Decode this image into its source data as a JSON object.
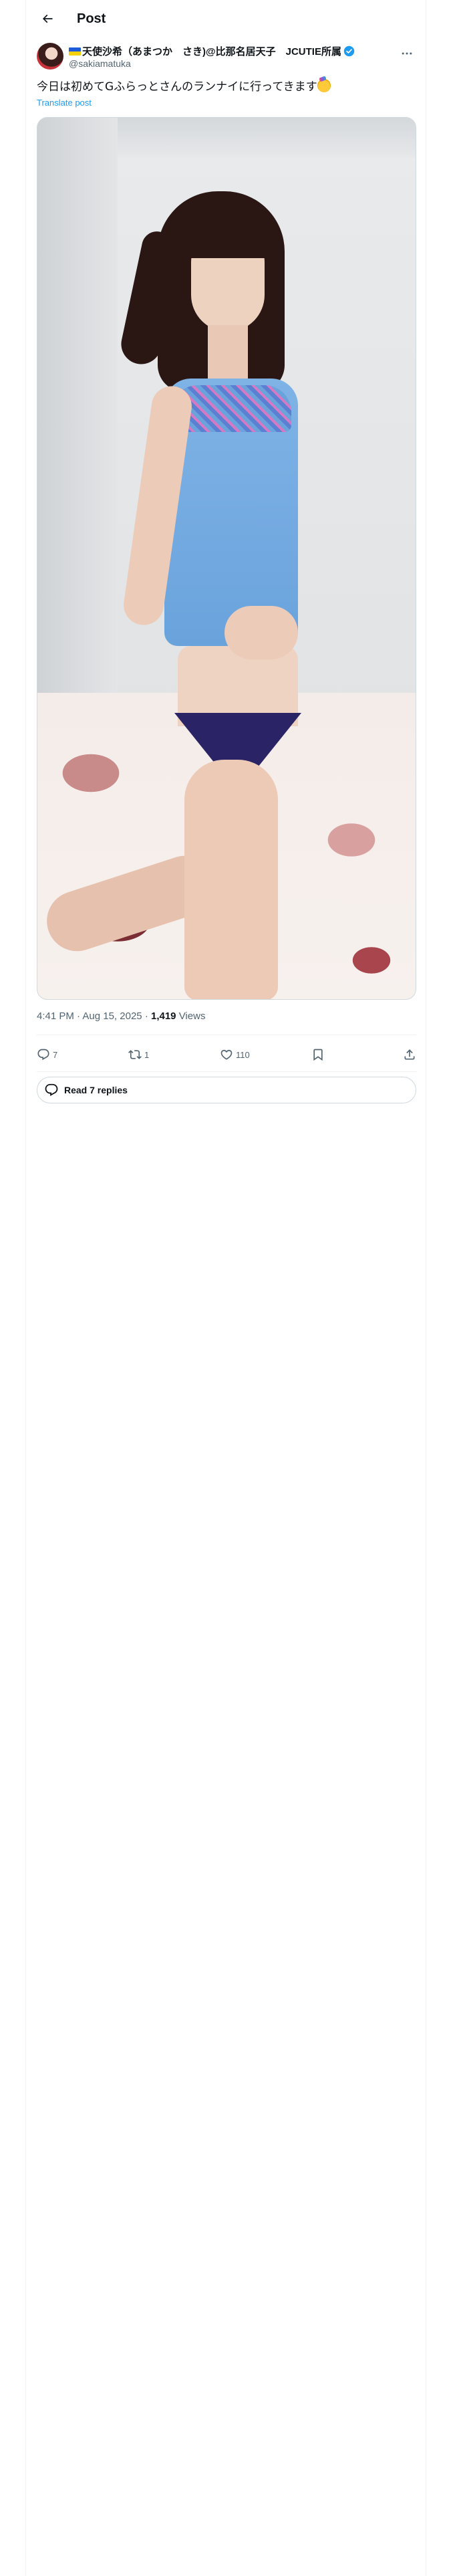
{
  "header": {
    "title": "Post"
  },
  "author": {
    "display_name": "天使沙希（あまつか　さき)@比那名居天子　JCUTIE所属",
    "handle": "@sakiamatuka"
  },
  "post": {
    "text": "今日は初めてGふらっとさんのランナイに行ってきます",
    "translate_label": "Translate post"
  },
  "meta": {
    "time": "4:41 PM",
    "separator": "·",
    "date": "Aug 15, 2025",
    "views_count": "1,419",
    "views_label": "Views"
  },
  "actions": {
    "replies": "7",
    "reposts": "1",
    "likes": "110"
  },
  "replies_button": {
    "label": "Read 7 replies"
  },
  "colors": {
    "text_primary": "#0f1419",
    "text_secondary": "#536471",
    "link": "#1d9bf0",
    "border": "#cfd9de",
    "verified": "#1d9bf0"
  }
}
